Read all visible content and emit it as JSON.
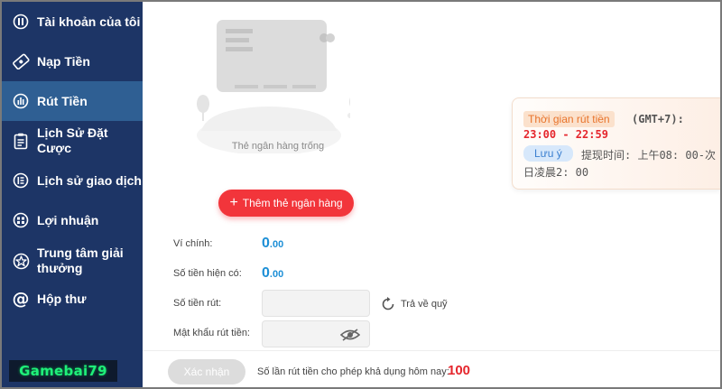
{
  "sidebar": {
    "items": [
      {
        "label": "Tài khoản của tôi",
        "icon": "account-icon"
      },
      {
        "label": "Nạp Tiền",
        "icon": "deposit-icon"
      },
      {
        "label": "Rút Tiền",
        "icon": "withdraw-icon",
        "active": true
      },
      {
        "label": "Lịch Sử Đặt Cược",
        "icon": "bet-history-icon"
      },
      {
        "label": "Lịch sử giao dịch",
        "icon": "transaction-history-icon"
      },
      {
        "label": "Lợi nhuận",
        "icon": "profit-icon"
      },
      {
        "label": "Trung tâm giải thưởng",
        "icon": "star-icon"
      },
      {
        "label": "Hộp thư",
        "icon": "at-icon"
      }
    ],
    "brand": "Gamebai79"
  },
  "bank_card": {
    "empty_text": "Thẻ ngân hàng trống",
    "add_button": "Thêm thẻ ngân hàng"
  },
  "balances": {
    "main_wallet_label": "Ví chính:",
    "main_wallet_int": "0",
    "main_wallet_dec": ".00",
    "available_label": "Số tiền hiện có:",
    "available_int": "0",
    "available_dec": ".00"
  },
  "form": {
    "amount_label": "Số tiền rút:",
    "amount_value": "",
    "password_label": "Mật khẩu rút tiền:",
    "password_value": "",
    "return_label": "Trả về quỹ"
  },
  "footer": {
    "confirm_label": "Xác nhận",
    "count_text": "Số lần rút tiền cho phép khả dụng hôm nay:",
    "count_value": "100"
  },
  "info": {
    "time_tag": "Thời gian rút tiền",
    "gmt": "(GMT+7):",
    "hours": "23:00 - 22:59",
    "note_tag": "Lưu ý",
    "note_line1": "提现时间: 上午08: 00-次",
    "note_line2": "日凌晨2: 00"
  },
  "colors": {
    "sidebar_bg": "#1d3566",
    "sidebar_active": "#2f5f93",
    "accent_red": "#f2353b",
    "money_blue": "#1d8fd6"
  }
}
